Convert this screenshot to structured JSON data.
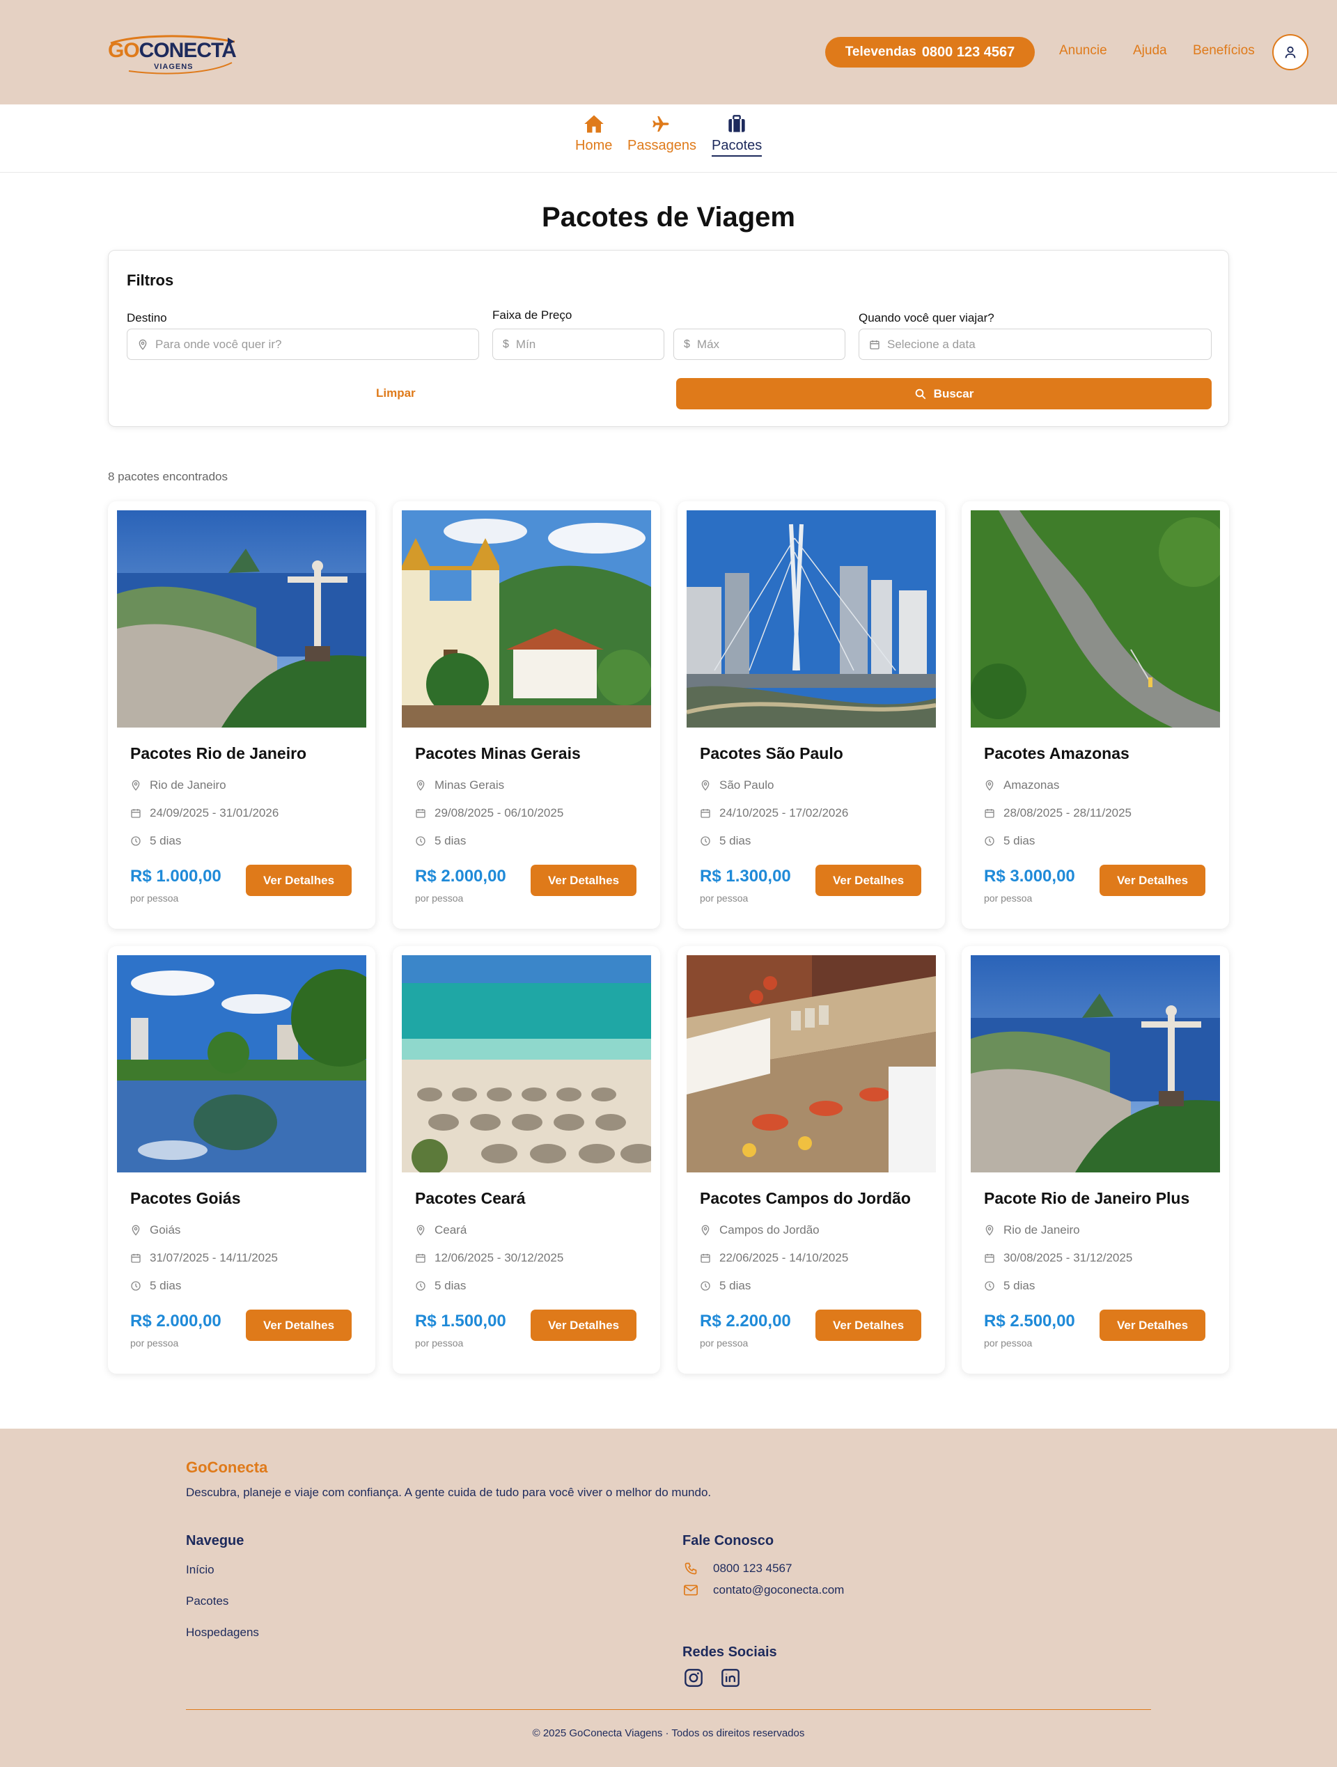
{
  "header": {
    "logo_text_go": "GO",
    "logo_text_conecta": "CONECTA",
    "logo_sub": "VIAGENS",
    "televendas_label": "Televendas",
    "televendas_number": "0800 123 4567",
    "links": [
      "Anuncie",
      "Ajuda",
      "Benefícios"
    ]
  },
  "nav": {
    "tabs": [
      {
        "label": "Home",
        "icon": "home-icon"
      },
      {
        "label": "Passagens",
        "icon": "plane-icon"
      },
      {
        "label": "Pacotes",
        "icon": "suitcase-icon",
        "active": true
      }
    ]
  },
  "page": {
    "title": "Pacotes de Viagem"
  },
  "filters": {
    "title": "Filtros",
    "destino_label": "Destino",
    "destino_placeholder": "Para onde você quer ir?",
    "preco_label": "Faixa de Preço",
    "min_placeholder": "Mín",
    "max_placeholder": "Máx",
    "data_label": "Quando você quer viajar?",
    "data_placeholder": "Selecione a data",
    "clear_label": "Limpar",
    "search_label": "Buscar"
  },
  "results": {
    "count_text": "8 pacotes encontrados"
  },
  "packages": [
    {
      "title": "Pacotes Rio de Janeiro",
      "location": "Rio de Janeiro",
      "dates": "24/09/2025 - 31/01/2026",
      "duration": "5 dias",
      "price": "R$ 1.000,00",
      "per": "por pessoa",
      "cta": "Ver Detalhes",
      "image": "rio-photo"
    },
    {
      "title": "Pacotes Minas Gerais",
      "location": "Minas Gerais",
      "dates": "29/08/2025 - 06/10/2025",
      "duration": "5 dias",
      "price": "R$ 2.000,00",
      "per": "por pessoa",
      "cta": "Ver Detalhes",
      "image": "minas-photo"
    },
    {
      "title": "Pacotes São Paulo",
      "location": "São Paulo",
      "dates": "24/10/2025 - 17/02/2026",
      "duration": "5 dias",
      "price": "R$ 1.300,00",
      "per": "por pessoa",
      "cta": "Ver Detalhes",
      "image": "saopaulo-photo"
    },
    {
      "title": "Pacotes Amazonas",
      "location": "Amazonas",
      "dates": "28/08/2025 - 28/11/2025",
      "duration": "5 dias",
      "price": "R$ 3.000,00",
      "per": "por pessoa",
      "cta": "Ver Detalhes",
      "image": "amazonas-photo"
    },
    {
      "title": "Pacotes Goiás",
      "location": "Goiás",
      "dates": "31/07/2025 - 14/11/2025",
      "duration": "5 dias",
      "price": "R$ 2.000,00",
      "per": "por pessoa",
      "cta": "Ver Detalhes",
      "image": "goias-photo"
    },
    {
      "title": "Pacotes Ceará",
      "location": "Ceará",
      "dates": "12/06/2025 - 30/12/2025",
      "duration": "5 dias",
      "price": "R$ 1.500,00",
      "per": "por pessoa",
      "cta": "Ver Detalhes",
      "image": "ceara-photo"
    },
    {
      "title": "Pacotes Campos do Jordão",
      "location": "Campos do Jordão",
      "dates": "22/06/2025 - 14/10/2025",
      "duration": "5 dias",
      "price": "R$ 2.200,00",
      "per": "por pessoa",
      "cta": "Ver Detalhes",
      "image": "campos-photo"
    },
    {
      "title": "Pacote Rio de Janeiro Plus",
      "location": "Rio de Janeiro",
      "dates": "30/08/2025 - 31/12/2025",
      "duration": "5 dias",
      "price": "R$ 2.500,00",
      "per": "por pessoa",
      "cta": "Ver Detalhes",
      "image": "rio-photo"
    }
  ],
  "footer": {
    "brand": "GoConecta",
    "tagline": "Descubra, planeje e viaje com confiança. A gente cuida de tudo para você viver o melhor do mundo.",
    "nav_heading": "Navegue",
    "nav_links": [
      "Início",
      "Pacotes",
      "Hospedagens"
    ],
    "contact_heading": "Fale Conosco",
    "phone": "0800 123 4567",
    "email": "contato@goconecta.com",
    "social_heading": "Redes Sociais",
    "social": [
      "instagram-icon",
      "linkedin-icon"
    ],
    "copyright": "© 2025 GoConecta Viagens · Todos os direitos reservados"
  },
  "colors": {
    "accent": "#df7a1a",
    "navy": "#1d2a5c",
    "price": "#1f8ad8",
    "header_bg": "#e5d1c3"
  }
}
